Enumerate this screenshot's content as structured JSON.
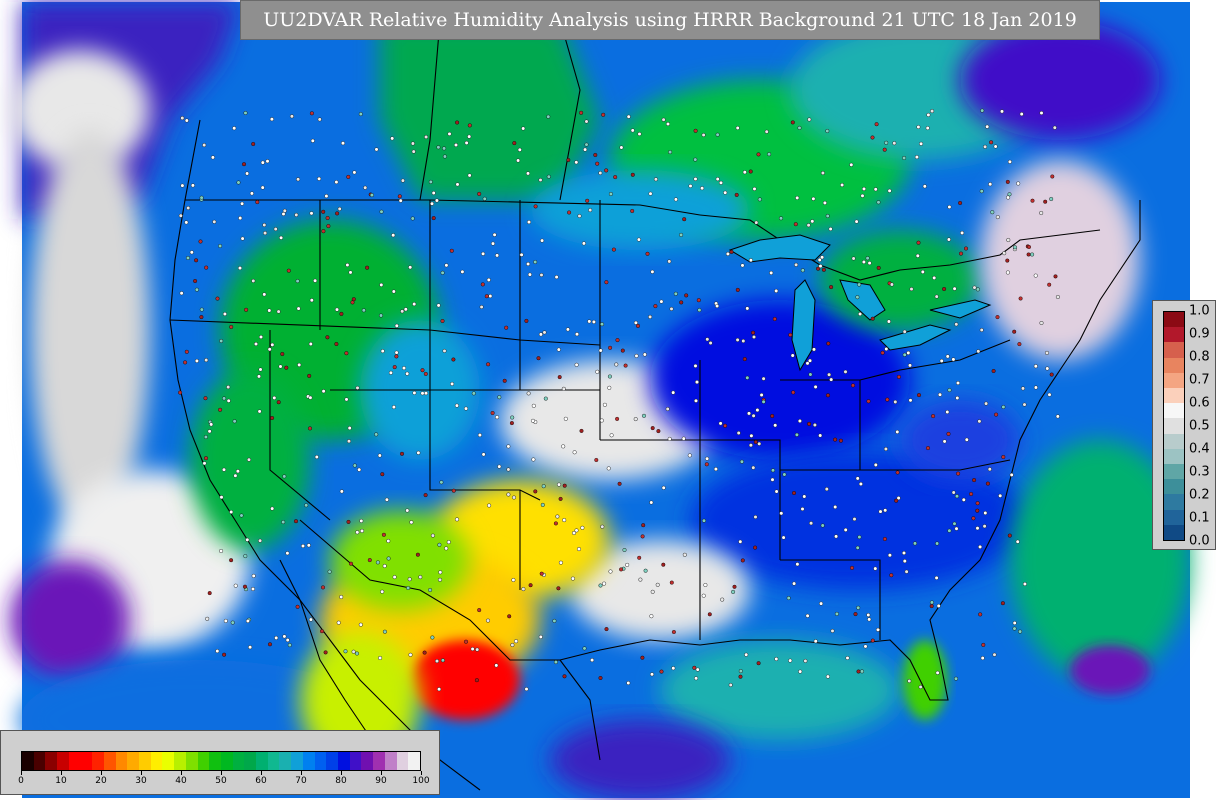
{
  "title": "UU2DVAR Relative Humidity Analysis using HRRR Background 21 UTC 18 Jan 2019",
  "rh_legend": {
    "ticks": [
      "0",
      "10",
      "20",
      "30",
      "40",
      "50",
      "60",
      "70",
      "80",
      "90",
      "100"
    ],
    "colors": [
      "#1a0000",
      "#4a0000",
      "#8a0000",
      "#c80000",
      "#ff0000",
      "#ff0000",
      "#ff2200",
      "#ff5500",
      "#ff8800",
      "#ffaa00",
      "#ffcc00",
      "#ffee00",
      "#eaff00",
      "#b8f000",
      "#7fe000",
      "#40d000",
      "#10c010",
      "#00b820",
      "#00b040",
      "#00a84a",
      "#00b070",
      "#10b890",
      "#1ab0b0",
      "#10a0d8",
      "#0080f0",
      "#0060f0",
      "#0040e8",
      "#0010e0",
      "#4010c8",
      "#7010b0",
      "#a030b0",
      "#c080c8",
      "#e0d0e0",
      "#f2f2f2"
    ]
  },
  "increment_legend": {
    "labels": [
      "1.0",
      "0.9",
      "0.8",
      "0.7",
      "0.6",
      "0.5",
      "0.4",
      "0.3",
      "0.2",
      "0.1",
      "0.0"
    ],
    "colors": [
      "#8b0a14",
      "#b2182b",
      "#d6604d",
      "#e8845f",
      "#f4a582",
      "#fbd0bb",
      "#f7f7f7",
      "#e0e0e0",
      "#b8cccc",
      "#9cc3c3",
      "#5fa6a6",
      "#3d8f9a",
      "#2e7aa0",
      "#20649a",
      "#104a85"
    ]
  },
  "colors": {
    "ocean_land_background": "#0a6ee0",
    "title_box": "#8f8f8f"
  }
}
